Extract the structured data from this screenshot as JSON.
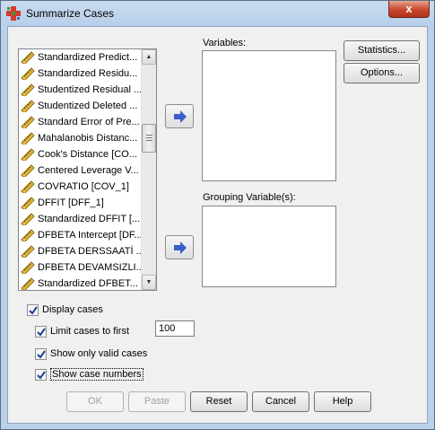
{
  "window": {
    "title": "Summarize Cases",
    "close_label": "x"
  },
  "source_list": {
    "items": [
      "Standardized Predict...",
      "Standardized Residu...",
      "Studentized Residual ...",
      "Studentized Deleted ...",
      "Standard Error of Pre...",
      "Mahalanobis Distanc...",
      "Cook's Distance [CO...",
      "Centered Leverage V...",
      "COVRATIO [COV_1]",
      "DFFIT [DFF_1]",
      "Standardized DFFIT [...",
      "DFBETA Intercept [DF...",
      "DFBETA DERSSAATİ ...",
      "DFBETA DEVAMSIZLI...",
      "Standardized DFBET..."
    ]
  },
  "variables": {
    "label": "Variables:"
  },
  "grouping": {
    "label": "Grouping Variable(s):"
  },
  "side_buttons": {
    "statistics": "Statistics...",
    "options": "Options..."
  },
  "options": {
    "display_cases": {
      "label": "Display cases",
      "checked": true
    },
    "limit_cases": {
      "label": "Limit cases to first",
      "checked": true,
      "value": "100"
    },
    "valid_only": {
      "label": "Show only valid cases",
      "checked": true
    },
    "case_numbers": {
      "label": "Show case numbers",
      "checked": true
    }
  },
  "footer": {
    "ok": "OK",
    "paste": "Paste",
    "reset": "Reset",
    "cancel": "Cancel",
    "help": "Help"
  },
  "colors": {
    "frame": "#b9d1ea",
    "close": "#c7472c",
    "arrow": "#3a5ec8"
  }
}
